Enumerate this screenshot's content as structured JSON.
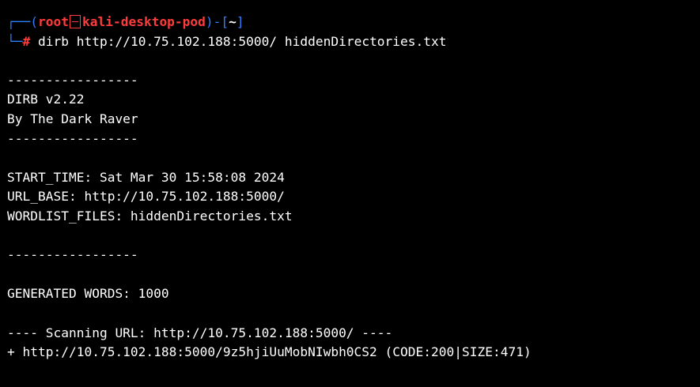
{
  "prompt": {
    "corner_top": "┌──",
    "open_paren": "(",
    "user": "root",
    "host": "kali-desktop-pod",
    "close_sep": ")-[",
    "cwd": "~",
    "close_bracket": "]",
    "corner_bottom": "└─",
    "symbol": "#",
    "command": "dirb http://10.75.102.188:5000/ hiddenDirectories.txt"
  },
  "output": {
    "separator": "-----------------",
    "banner_title": "DIRB v2.22",
    "banner_author": "By The Dark Raver",
    "start_time": "START_TIME: Sat Mar 30 15:58:08 2024",
    "url_base": "URL_BASE: http://10.75.102.188:5000/",
    "wordlist": "WORDLIST_FILES: hiddenDirectories.txt",
    "generated_words": "GENERATED WORDS: 1000",
    "scanning": "---- Scanning URL: http://10.75.102.188:5000/ ----",
    "result": "+ http://10.75.102.188:5000/9z5hjiUuMobNIwbh0CS2 (CODE:200|SIZE:471)"
  },
  "colors": {
    "background": "#000000",
    "text": "#ffffff",
    "prompt_blue": "#2f80ff",
    "prompt_red": "#ff3b3b"
  }
}
